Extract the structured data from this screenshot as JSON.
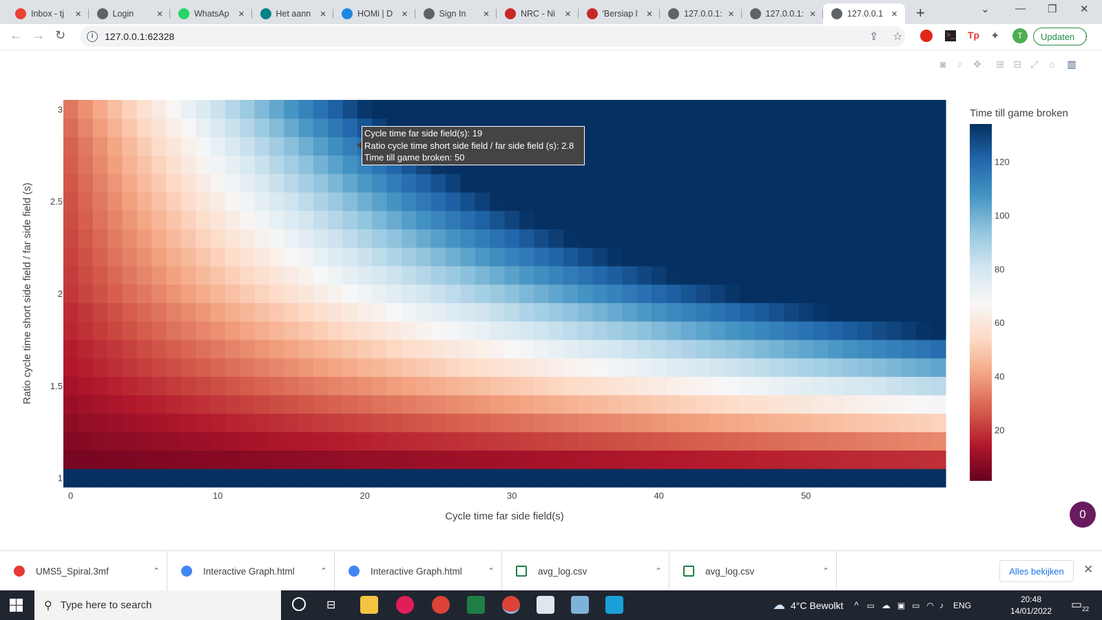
{
  "browser": {
    "tabs": [
      {
        "title": "Inbox - tj",
        "icon": "gmail-icon",
        "color": "#ea4335"
      },
      {
        "title": "Login",
        "icon": "globe-icon",
        "color": "#5f6368"
      },
      {
        "title": "WhatsAp",
        "icon": "whatsapp-icon",
        "color": "#25d366"
      },
      {
        "title": "Het aann",
        "icon": "sharepoint-icon",
        "color": "#038387"
      },
      {
        "title": "HOMi | D",
        "icon": "homi-icon",
        "color": "#1e88e5"
      },
      {
        "title": "Sign In",
        "icon": "globe-icon",
        "color": "#5f6368"
      },
      {
        "title": "NRC - Ni",
        "icon": "nrc-icon",
        "color": "#c62828"
      },
      {
        "title": "'Bersiap l",
        "icon": "nrc-icon",
        "color": "#c62828"
      },
      {
        "title": "127.0.0.1:",
        "icon": "globe-icon",
        "color": "#5f6368"
      },
      {
        "title": "127.0.0.1:",
        "icon": "globe-icon",
        "color": "#5f6368"
      },
      {
        "title": "127.0.0.1",
        "icon": "globe-icon",
        "color": "#5f6368",
        "active": true
      }
    ],
    "address": "127.0.0.1:62328",
    "update_label": "Updaten",
    "avatar_initial": "T"
  },
  "chart_data": {
    "type": "heatmap",
    "title": "",
    "xlabel": "Cycle time far side field(s)",
    "ylabel": "Ratio cycle time short side field / far side field (s)",
    "x": {
      "start": 0,
      "step": 1,
      "count": 60
    },
    "y": {
      "start": 1.0,
      "step": 0.1,
      "count": 21
    },
    "xlim": [
      -0.5,
      59.5
    ],
    "ylim": [
      0.95,
      3.05
    ],
    "xticks": [
      0,
      10,
      20,
      30,
      40,
      50
    ],
    "yticks": [
      1,
      1.5,
      2,
      2.5,
      3
    ],
    "ytick_labels": [
      "1",
      "1.5",
      "2",
      "2.5",
      "3"
    ],
    "z_max": 134,
    "z_row_formula": "z = min(z_max, x * (ratio - 1) * 2.5 + z_row_offset)",
    "z_row_offset": [
      134,
      4,
      6,
      8,
      10,
      12,
      14,
      15,
      17,
      18,
      20,
      21,
      22,
      23,
      24,
      25,
      26,
      27,
      28,
      30,
      32
    ],
    "colorscale": "RdBu",
    "colorbar": {
      "title": "Time till game broken",
      "range": [
        1,
        134
      ],
      "ticks": [
        20,
        40,
        60,
        80,
        100,
        120
      ]
    },
    "hover": {
      "x": 19,
      "y": 2.8,
      "z": 50,
      "lines": [
        "Cycle time far side field(s): 19",
        "Ratio cycle time short side field / far side field (s): 2.8",
        "Time till game broken: 50"
      ]
    }
  },
  "widgets": {
    "badge_count": "0"
  },
  "downloads": {
    "items": [
      {
        "name": "UMS5_Spiral.3mf",
        "icon": "cura-icon",
        "color": "#e53935"
      },
      {
        "name": "Interactive Graph.html",
        "icon": "chrome-icon",
        "color": "#4285f4"
      },
      {
        "name": "Interactive Graph.html",
        "icon": "chrome-icon",
        "color": "#4285f4"
      },
      {
        "name": "avg_log.csv",
        "icon": "excel-icon",
        "color": "#1e7e45"
      },
      {
        "name": "avg_log.csv",
        "icon": "excel-icon",
        "color": "#1e7e45"
      }
    ],
    "show_all_label": "Alles bekijken"
  },
  "taskbar": {
    "search_placeholder": "Type here to search",
    "weather": "4°C Bewolkt",
    "language": "ENG",
    "time": "20:48",
    "date": "14/01/2022",
    "notification_count": "22"
  }
}
